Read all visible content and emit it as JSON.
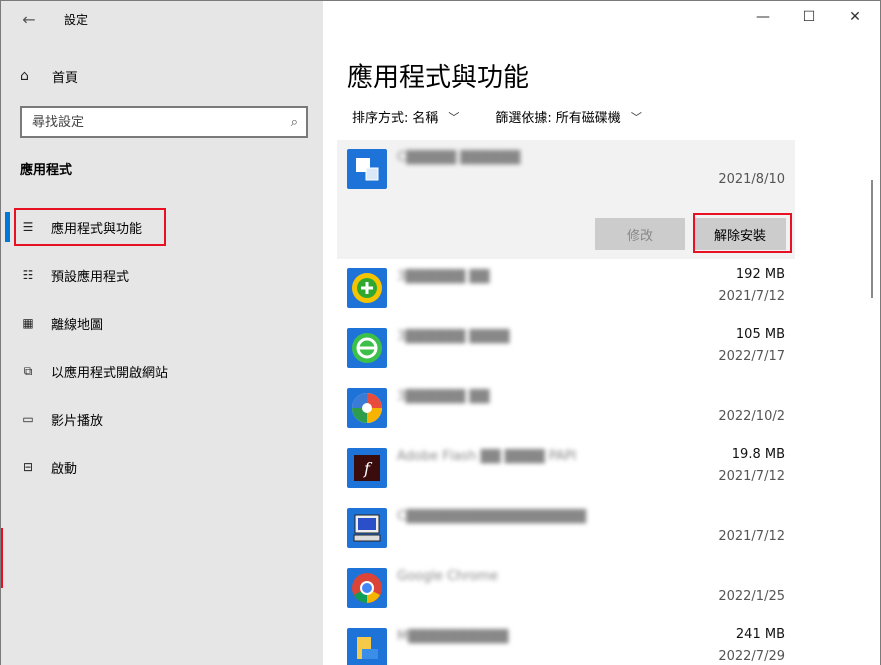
{
  "window": {
    "title": "設定",
    "controls": {
      "minimize": "—",
      "maximize": "☐",
      "close": "✕"
    }
  },
  "sidebar": {
    "home": "首頁",
    "search_placeholder": "尋找設定",
    "section_title": "應用程式",
    "items": [
      {
        "label": "應用程式與功能",
        "icon": "apps-features-icon",
        "active": true
      },
      {
        "label": "預設應用程式",
        "icon": "default-apps-icon"
      },
      {
        "label": "離線地圖",
        "icon": "offline-maps-icon"
      },
      {
        "label": "以應用程式開啟網站",
        "icon": "apps-for-websites-icon"
      },
      {
        "label": "影片播放",
        "icon": "video-playback-icon"
      },
      {
        "label": "啟動",
        "icon": "startup-icon"
      }
    ]
  },
  "main": {
    "title": "應用程式與功能",
    "sort_label": "排序方式:",
    "sort_value": "名稱",
    "filter_label": "篩選依據:",
    "filter_value": "所有磁碟機",
    "modify_label": "修改",
    "uninstall_label": "解除安裝",
    "apps": [
      {
        "name": "C█████ ██████",
        "size": "",
        "date": "2021/8/10",
        "color": "#1e73d8",
        "selected": true
      },
      {
        "name": "3██████ ██",
        "size": "192 MB",
        "date": "2021/7/12",
        "color": "#1e73d8"
      },
      {
        "name": "3██████ ████",
        "size": "105 MB",
        "date": "2022/7/17",
        "color": "#1e73d8"
      },
      {
        "name": "3██████ ██",
        "size": "",
        "date": "2022/10/2",
        "color": "#1e73d8"
      },
      {
        "name": "Adobe Flash ██ ████ PAPI",
        "size": "19.8 MB",
        "date": "2021/7/12",
        "color": "#1e73d8"
      },
      {
        "name": "C██████████████████",
        "size": "",
        "date": "2021/7/12",
        "color": "#1e73d8"
      },
      {
        "name": "Google Chrome",
        "size": "",
        "date": "2022/1/25",
        "color": "#1e73d8"
      },
      {
        "name": "M██████████",
        "size": "241 MB",
        "date": "2022/7/29",
        "color": "#1e73d8"
      }
    ]
  }
}
